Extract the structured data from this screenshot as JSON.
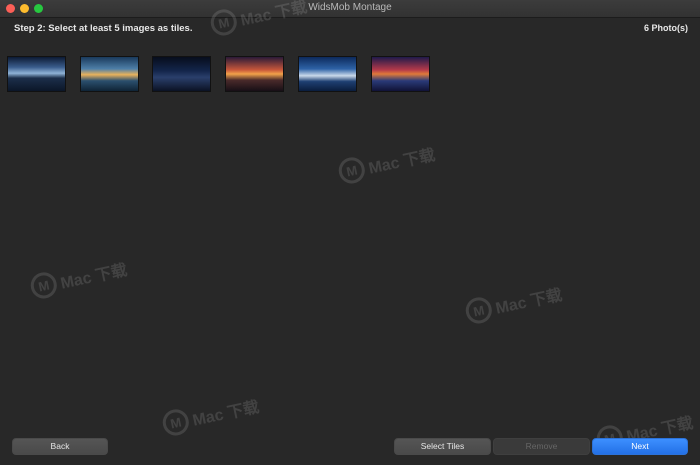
{
  "window": {
    "title": "WidsMob Montage"
  },
  "header": {
    "step_label": "Step 2: Select at least 5 images as tiles.",
    "photo_count": "6 Photo(s)"
  },
  "thumbnails": [
    {
      "name": "thumbnail-1"
    },
    {
      "name": "thumbnail-2"
    },
    {
      "name": "thumbnail-3"
    },
    {
      "name": "thumbnail-4"
    },
    {
      "name": "thumbnail-5"
    },
    {
      "name": "thumbnail-6"
    }
  ],
  "footer": {
    "back_label": "Back",
    "select_tiles_label": "Select Tiles",
    "remove_label": "Remove",
    "next_label": "Next"
  },
  "watermark": {
    "text": "Mac 下载"
  },
  "colors": {
    "background": "#282828",
    "accent": "#2370e6",
    "close": "#fc5f57",
    "minimize": "#fdbc2e",
    "zoom": "#27c840"
  }
}
